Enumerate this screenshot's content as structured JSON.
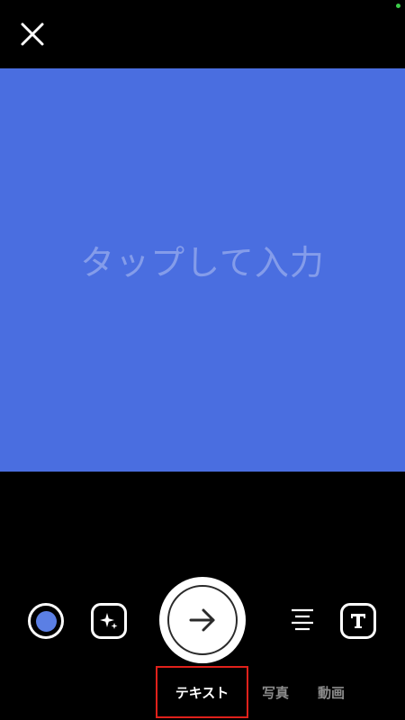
{
  "canvas": {
    "placeholder": "タップして入力",
    "background_color": "#4a6ee0"
  },
  "toolbar": {
    "color_picker_color": "#5b7fe4",
    "icons": {
      "close": "close-icon",
      "color": "color-picker-icon",
      "effects": "sparkle-icon",
      "send": "arrow-right-icon",
      "align": "align-center-icon",
      "font": "text-style-icon"
    }
  },
  "mode_tabs": [
    {
      "label": "テキスト",
      "active": true
    },
    {
      "label": "写真",
      "active": false
    },
    {
      "label": "動画",
      "active": false
    }
  ],
  "colors": {
    "status_indicator": "#3ccc4a",
    "active_tab_outline": "#e0211b"
  }
}
